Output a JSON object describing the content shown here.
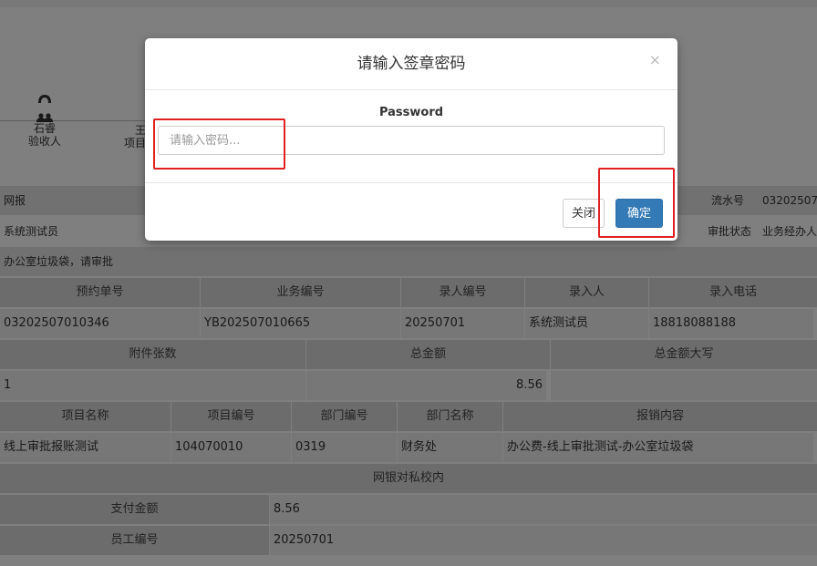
{
  "flow": {
    "person1": {
      "name": "石睿",
      "role": "验收人"
    },
    "person2": {
      "name": "王",
      "role": "项目"
    }
  },
  "info": {
    "row1": {
      "left": "网报",
      "label": "流水号",
      "value": "03202507"
    },
    "row2": {
      "left": "系统测试员",
      "label": "审批状态",
      "value": "业务经办人"
    },
    "row3": {
      "left": "办公室垃圾袋，请审批"
    }
  },
  "table1": {
    "headers": [
      "预约单号",
      "业务编号",
      "录人编号",
      "录入人",
      "录入电话"
    ],
    "values": [
      "03202507010346",
      "YB202507010665",
      "20250701",
      "系统测试员",
      "18818088188"
    ]
  },
  "table2": {
    "headers": [
      "附件张数",
      "总金额",
      "总金额大写"
    ],
    "values": [
      "1",
      "8.56",
      ""
    ]
  },
  "table3": {
    "headers": [
      "项目名称",
      "项目编号",
      "部门编号",
      "部门名称",
      "报销内容"
    ],
    "values": [
      "线上审批报账测试",
      "104070010",
      "0319",
      "财务处",
      "办公费-线上审批测试-办公室垃圾袋"
    ]
  },
  "payment": {
    "title": "网银对私校内",
    "rows": [
      {
        "label": "支付金额",
        "value": "8.56"
      },
      {
        "label": "员工编号",
        "value": "20250701"
      }
    ]
  },
  "modal": {
    "title": "请输入签章密码",
    "close_icon": "×",
    "field_label": "Password",
    "placeholder": "请输入密码...",
    "btn_close": "关闭",
    "btn_ok": "确定"
  },
  "colors": {
    "primary": "#337ab7",
    "highlight": "#e02020"
  }
}
